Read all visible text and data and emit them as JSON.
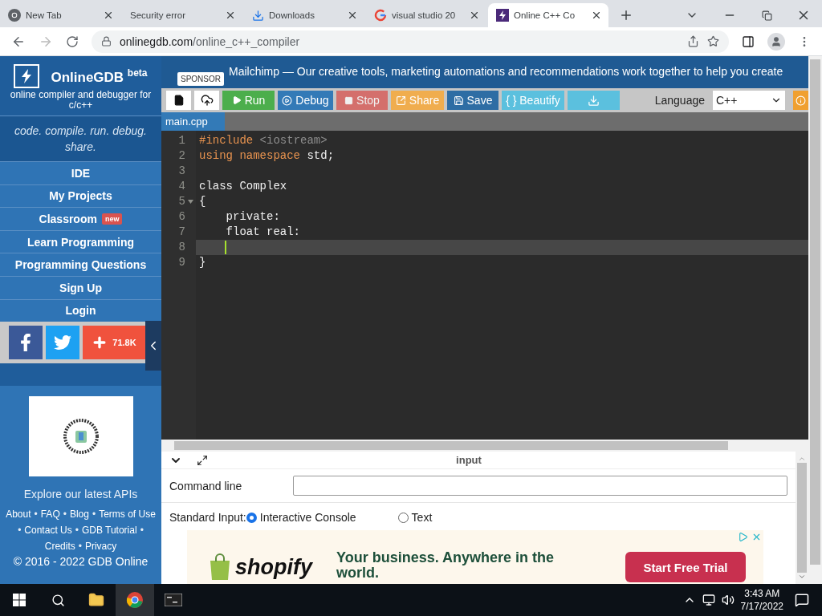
{
  "browser": {
    "tabs": [
      {
        "title": "New Tab",
        "kind": "chrome",
        "selected": false
      },
      {
        "title": "Security error",
        "selected": false
      },
      {
        "title": "Downloads",
        "kind": "download",
        "selected": false
      },
      {
        "title": "visual studio 20",
        "kind": "google",
        "selected": false
      },
      {
        "title": "Online C++ Co",
        "kind": "gdb",
        "selected": true
      }
    ],
    "address": {
      "domain": "onlinegdb.com",
      "path": "/online_c++_compiler"
    }
  },
  "sidebar": {
    "brand": "OnlineGDB",
    "brand_badge": "beta",
    "subtitle": "online compiler and debugger for c/c++",
    "tagline": "code. compile. run. debug. share.",
    "nav": [
      {
        "label": "IDE"
      },
      {
        "label": "My Projects"
      },
      {
        "label": "Classroom",
        "badge": "new"
      },
      {
        "label": "Learn Programming"
      },
      {
        "label": "Programming Questions"
      },
      {
        "label": "Sign Up"
      },
      {
        "label": "Login"
      }
    ],
    "share_count": "71.8K",
    "promo": "Explore our latest APIs",
    "footer_links": [
      "About",
      "FAQ",
      "Blog",
      "Terms of Use",
      "Contact Us",
      "GDB Tutorial",
      "Credits",
      "Privacy"
    ],
    "footer_separator": "•",
    "copyright": "© 2016 - 2022 GDB Online"
  },
  "sponsor": {
    "badge": "SPONSOR",
    "text": "Mailchimp — Our creative tools, marketing automations and recommendations work together to help you create"
  },
  "toolbar": {
    "buttons": [
      {
        "kind": "new-file"
      },
      {
        "kind": "upload"
      },
      {
        "kind": "run",
        "label": "Run"
      },
      {
        "kind": "debug",
        "label": "Debug"
      },
      {
        "kind": "stop",
        "label": "Stop",
        "disabled": true
      },
      {
        "kind": "share",
        "label": "Share"
      },
      {
        "kind": "save",
        "label": "Save"
      },
      {
        "kind": "beautify",
        "label": "{ } Beautify"
      },
      {
        "kind": "download"
      }
    ],
    "language_label": "Language",
    "language": "C++"
  },
  "editor": {
    "file_tab": "main.cpp",
    "lines": [
      {
        "number": "1",
        "active": false,
        "foldable": false,
        "tokens": [
          {
            "t": "#include",
            "kind": "keyword"
          },
          {
            "t": " <iostream>",
            "kind": "muted"
          }
        ]
      },
      {
        "number": "2",
        "active": false,
        "foldable": false,
        "tokens": [
          {
            "t": "using namespace",
            "kind": "keyword"
          },
          {
            "t": " std;",
            "kind": "plain"
          }
        ]
      },
      {
        "number": "3",
        "active": false,
        "foldable": false
      },
      {
        "number": "4",
        "active": false,
        "foldable": false,
        "tokens": [
          {
            "t": "class Complex",
            "kind": "plain"
          }
        ]
      },
      {
        "number": "5",
        "active": false,
        "foldable": true,
        "tokens": [
          {
            "t": "{",
            "kind": "plain"
          }
        ]
      },
      {
        "number": "6",
        "active": false,
        "foldable": false,
        "tokens": [
          {
            "t": "    private:",
            "kind": "plain"
          }
        ]
      },
      {
        "number": "7",
        "active": false,
        "foldable": false,
        "tokens": [
          {
            "t": "    float real:",
            "kind": "plain"
          }
        ]
      },
      {
        "number": "8",
        "active": true,
        "foldable": false
      },
      {
        "number": "9",
        "active": false,
        "foldable": false,
        "tokens": [
          {
            "t": "}",
            "kind": "plain"
          }
        ]
      }
    ]
  },
  "input_panel": {
    "title": "input",
    "command_line_label": "Command line",
    "standard_input_label": "Standard Input:",
    "options": [
      {
        "label": "Interactive Console",
        "selected": true
      },
      {
        "label": "Text",
        "selected": false
      }
    ]
  },
  "ad": {
    "brand": "shopify",
    "headline": "Your business. Anywhere in the world.",
    "cta": "Start Free Trial"
  },
  "taskbar": {
    "time": "3:43 AM",
    "date": "7/17/2022"
  }
}
